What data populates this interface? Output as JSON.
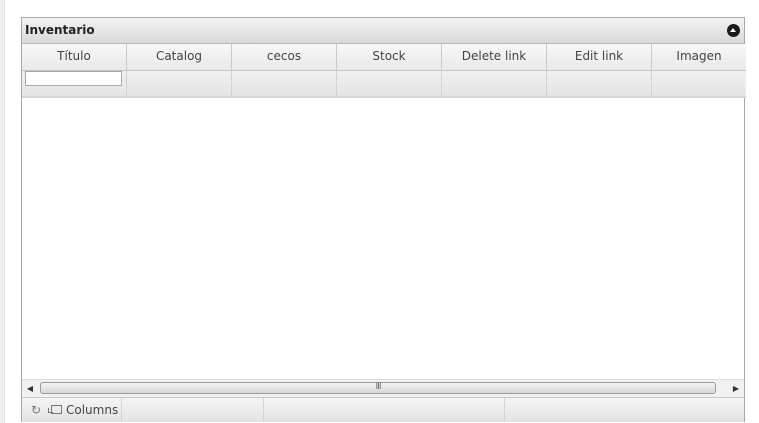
{
  "panel": {
    "title": "Inventario"
  },
  "columns": [
    {
      "label": "Título"
    },
    {
      "label": "Catalog"
    },
    {
      "label": "cecos"
    },
    {
      "label": "Stock"
    },
    {
      "label": "Delete link"
    },
    {
      "label": "Edit link"
    },
    {
      "label": "Imagen"
    }
  ],
  "filters": {
    "titulo_value": ""
  },
  "scrollbar": {
    "grip": "III"
  },
  "footer": {
    "refresh_icon": "refresh-icon",
    "columns_label": "Columns"
  }
}
